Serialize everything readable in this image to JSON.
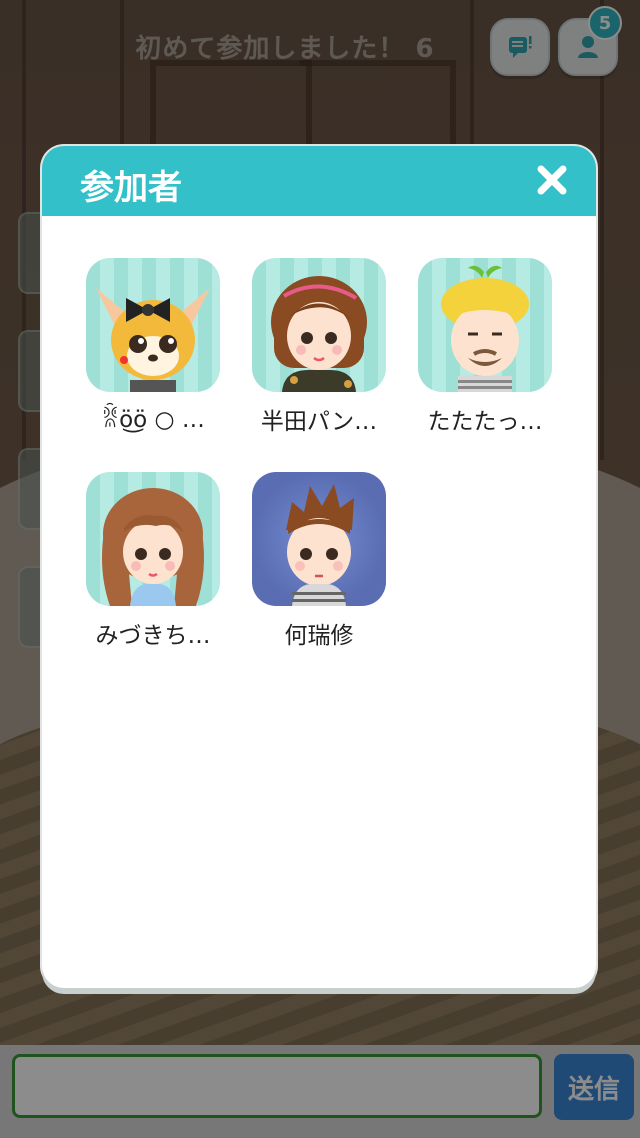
{
  "header": {
    "title": "初めて参加しました！",
    "count": "6",
    "participants_badge": "5",
    "chat_icon": "chat-bubble-icon",
    "participants_icon": "person-icon"
  },
  "modal": {
    "title": "参加者",
    "close_icon": "close-icon",
    "members": [
      {
        "name": "ꐠö͜ö ○ …",
        "avatar": "deer-avatar"
      },
      {
        "name": "半田パン…",
        "avatar": "brown-hair-girl-avatar"
      },
      {
        "name": "たたたっ…",
        "avatar": "blonde-sprout-avatar"
      },
      {
        "name": "みづきち…",
        "avatar": "wavy-hair-girl-avatar"
      },
      {
        "name": "何瑞修",
        "avatar": "spiky-hair-boy-avatar"
      }
    ]
  },
  "composer": {
    "input_value": "",
    "input_placeholder": "",
    "send_label": "送信"
  },
  "colors": {
    "accent": "#33c0c8",
    "send": "#3a88d8",
    "input_border": "#3a9a3a"
  }
}
